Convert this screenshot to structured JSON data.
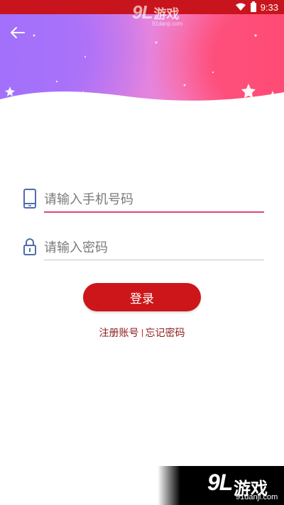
{
  "status_bar": {
    "time": "9:33"
  },
  "header": {
    "back_icon": "arrow-left-icon"
  },
  "form": {
    "phone_placeholder": "请输入手机号码",
    "password_placeholder": "请输入密码",
    "phone_icon": "phone-icon",
    "password_icon": "lock-icon",
    "login_label": "登录"
  },
  "links": {
    "register": "注册账号",
    "forgot_password": "忘记密码"
  },
  "watermark": {
    "logo_number": "9L",
    "logo_text": "游戏",
    "url": "91danji.com"
  },
  "colors": {
    "accent": "#cc161a",
    "input_active_underline": "#e0457a",
    "link": "#8e1b1b"
  }
}
